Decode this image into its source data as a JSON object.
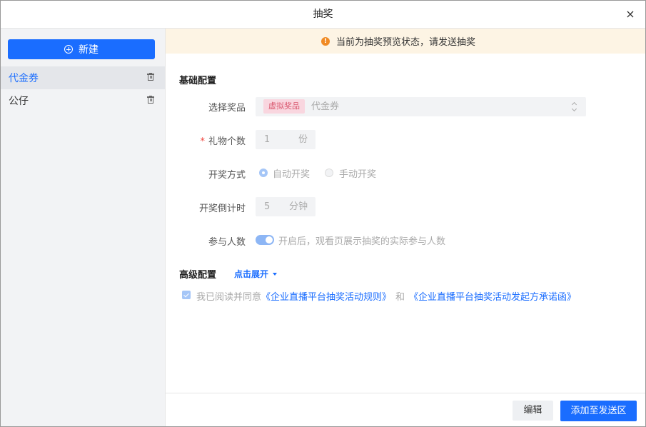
{
  "dialog": {
    "title": "抽奖",
    "close_label": "×"
  },
  "sidebar": {
    "new_button": "新建",
    "items": [
      {
        "label": "代金券",
        "active": true
      },
      {
        "label": "公仔",
        "active": false
      }
    ]
  },
  "banner": {
    "text": "当前为抽奖预览状态，请发送抽奖",
    "icon_glyph": "!"
  },
  "basic": {
    "title": "基础配置",
    "prize": {
      "label": "选择奖品",
      "tag": "虚拟奖品",
      "value": "代金券"
    },
    "count": {
      "required_mark": "*",
      "label": "礼物个数",
      "value": "1",
      "unit": "份"
    },
    "draw_mode": {
      "label": "开奖方式",
      "options": [
        "自动开奖",
        "手动开奖"
      ],
      "selected": "自动开奖"
    },
    "countdown": {
      "label": "开奖倒计时",
      "value": "5",
      "unit": "分钟"
    },
    "participants": {
      "label": "参与人数",
      "enabled": true,
      "hint": "开启后，观看页展示抽奖的实际参与人数"
    }
  },
  "advanced": {
    "title": "高级配置",
    "expand_label": "点击展开"
  },
  "agreement": {
    "checked": true,
    "prefix": "我已阅读并同意",
    "rule_link": "《企业直播平台抽奖活动规则》",
    "conj": "和",
    "promise_link": "《企业直播平台抽奖活动发起方承诺函》"
  },
  "footer": {
    "edit_button": "编辑",
    "add_button": "添加至发送区"
  },
  "colors": {
    "primary": "#1a6dff",
    "warning": "#f08a24",
    "banner_bg": "#fdf4e4",
    "tag_bg": "#f9d6df",
    "tag_text": "#d9576e"
  }
}
